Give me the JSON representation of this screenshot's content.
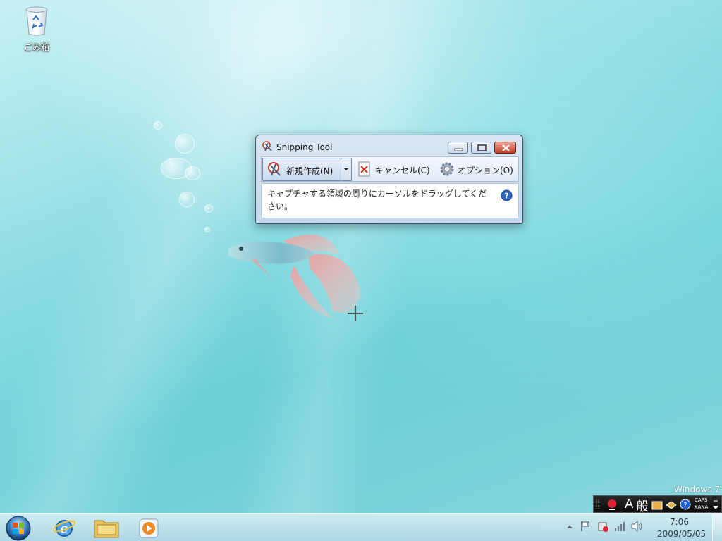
{
  "desktop": {
    "recycle_bin_label": "ごみ箱",
    "watermark": "Windows 7"
  },
  "snipping_tool": {
    "title": "Snipping Tool",
    "toolbar": {
      "new_label": "新規作成(N)",
      "cancel_label": "キャンセル(C)",
      "options_label": "オプション(O)"
    },
    "message": "キャプチャする領域の周りにカーソルをドラッグしてください。"
  },
  "language_bar": {
    "ime_mode": "A",
    "ime_label": "般",
    "caps": "CAPS",
    "kana": "KANA"
  },
  "taskbar": {
    "apps": [
      {
        "icon": "internet-explorer-icon"
      },
      {
        "icon": "windows-explorer-icon"
      },
      {
        "icon": "media-player-icon"
      }
    ],
    "clock": {
      "time": "7:06",
      "date": "2009/05/05"
    }
  },
  "colors": {
    "accent": "#3a6ea5",
    "close_button": "#c13c21"
  }
}
